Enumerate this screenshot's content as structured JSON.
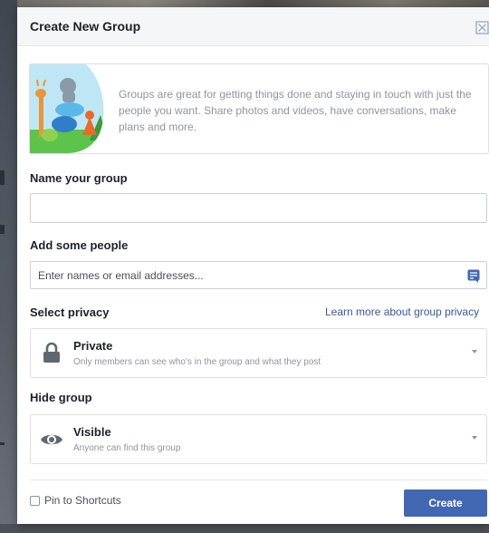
{
  "dialog": {
    "title": "Create New Group"
  },
  "intro": {
    "text": "Groups are great for getting things done and staying in touch with just the people you want. Share photos and videos, have conversations, make plans and more."
  },
  "name_section": {
    "label": "Name your group",
    "value": "",
    "placeholder": ""
  },
  "people_section": {
    "label": "Add some people",
    "value": "",
    "placeholder": "Enter names or email addresses..."
  },
  "privacy_section": {
    "label": "Select privacy",
    "link": "Learn more about group privacy",
    "selected_title": "Private",
    "selected_desc": "Only members can see who's in the group and what they post",
    "icon": "lock-icon"
  },
  "hide_section": {
    "label": "Hide group",
    "selected_title": "Visible",
    "selected_desc": "Anyone can find this group",
    "icon": "eye-icon"
  },
  "footer": {
    "pin_label": "Pin to Shortcuts",
    "pin_checked": false,
    "create_label": "Create"
  },
  "colors": {
    "primary_button": "#4267b2",
    "link": "#385898",
    "header_bg": "#f5f6f7",
    "muted_text": "#90949c"
  }
}
